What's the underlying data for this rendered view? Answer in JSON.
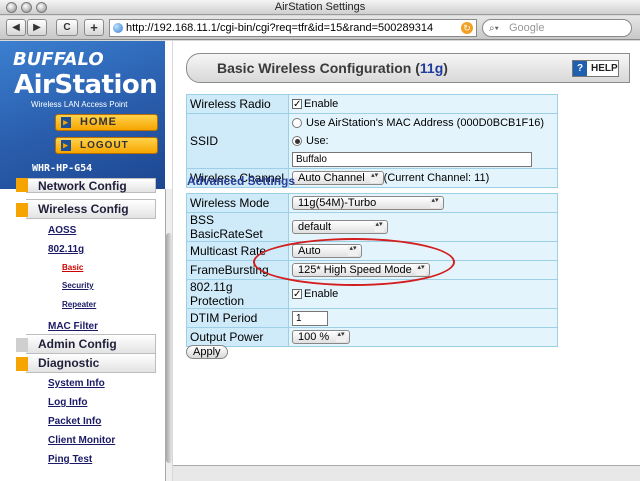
{
  "window": {
    "title": "AirStation Settings"
  },
  "toolbar": {
    "back": "◀",
    "forward": "▶",
    "reload": "C",
    "add": "+",
    "url": "http://192.168.11.1/cgi-bin/cgi?req=tfr&id=15&rand=500289314",
    "search_placeholder": "Google"
  },
  "brand": {
    "logo_top": "BUFFALO",
    "logo_main": "AirStation",
    "tagline": "Wireless LAN Access Point",
    "home_label": "HOME",
    "logout_label": "LOGOUT",
    "model": "WHR-HP-G54"
  },
  "nav": {
    "partial_section": "Network Config",
    "sections": [
      {
        "label": "Wireless Config"
      },
      {
        "label": "Admin Config"
      },
      {
        "label": "Diagnostic"
      }
    ],
    "wireless_links": [
      {
        "label": "AOSS"
      },
      {
        "label": "802.11g"
      }
    ],
    "sub_links": [
      {
        "label": "Basic",
        "active": true
      },
      {
        "label": "Security"
      },
      {
        "label": "Repeater"
      }
    ],
    "mac_filter": "MAC Filter",
    "diagnostic_links": [
      {
        "label": "System Info"
      },
      {
        "label": "Log Info"
      },
      {
        "label": "Packet Info"
      },
      {
        "label": "Client Monitor"
      },
      {
        "label": "Ping Test"
      }
    ]
  },
  "page": {
    "title_prefix": "Basic Wireless Configuration (",
    "title_accent": "11g",
    "title_suffix": ")",
    "help_icon": "?",
    "help_label": "HELP",
    "advanced_heading": "Advanced Settings",
    "apply_label": "Apply"
  },
  "basic": {
    "wireless_radio": {
      "label": "Wireless Radio",
      "checkbox_label": "Enable",
      "checked": true
    },
    "ssid": {
      "label": "SSID",
      "option_mac": "Use AirStation's MAC Address (000D0BCB1F16)",
      "option_use": "Use:",
      "value": "Buffalo"
    },
    "channel": {
      "label": "Wireless Channel",
      "value": "Auto Channel",
      "current": "(Current Channel: 11)"
    }
  },
  "advanced": {
    "mode": {
      "label": "Wireless Mode",
      "value": "11g(54M)-Turbo"
    },
    "bss": {
      "label": "BSS BasicRateSet",
      "value": "default"
    },
    "multicast": {
      "label": "Multicast Rate",
      "value": "Auto"
    },
    "framebursting": {
      "label": "FrameBursting",
      "value": "125* High Speed Mode"
    },
    "protection": {
      "label": "802.11g Protection",
      "checkbox_label": "Enable",
      "checked": true
    },
    "dtim": {
      "label": "DTIM Period",
      "value": "1"
    },
    "power": {
      "label": "Output Power",
      "value": "100 %"
    }
  },
  "glyphs": {
    "check": "✓",
    "chevron": "▴▾",
    "arrow": "▸"
  },
  "colors": {
    "accent": "#1f3a9e",
    "highlight_ellipse": "#d21e1e",
    "nav_orange": "#f6a500"
  }
}
